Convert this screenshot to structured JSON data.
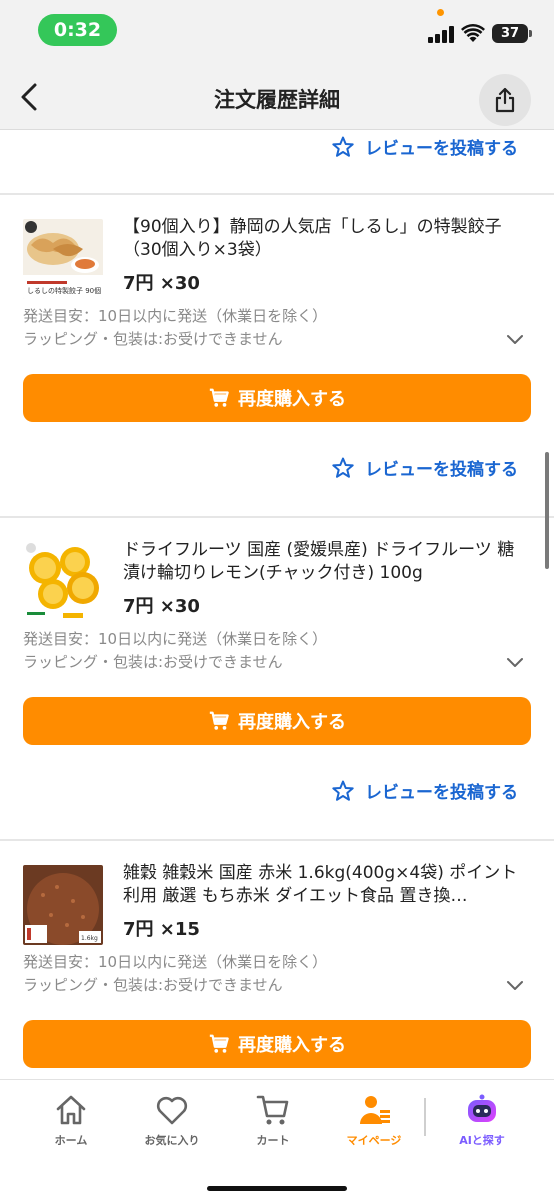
{
  "status_bar": {
    "time": "0:32",
    "battery": "37"
  },
  "header": {
    "title": "注文履歴詳細"
  },
  "review_label": "レビューを投稿する",
  "items": [
    {
      "title": "【90個入り】静岡の人気店「しるし」の特製餃子（30個入り×3袋）",
      "price": "7円 ×30",
      "ship": "発送目安：10日以内に発送（休業日を除く）",
      "wrap": "ラッピング・包装は:お受けできません",
      "button": "再度購入する",
      "thumb_label": "しるしの特製餃子 90個"
    },
    {
      "title": "ドライフルーツ 国産 (愛媛県産) ドライフルーツ 糖漬け輪切りレモン(チャック付き) 100g",
      "price": "7円 ×30",
      "ship": "発送目安：10日以内に発送（休業日を除く）",
      "wrap": "ラッピング・包装は:お受けできません",
      "button": "再度購入する"
    },
    {
      "title": "雑穀 雑穀米 国産 赤米 1.6kg(400g×4袋) ポイント利用 厳選 もち赤米 ダイエット食品 置き換…",
      "price": "7円 ×15",
      "ship": "発送目安：10日以内に発送（休業日を除く）",
      "wrap": "ラッピング・包装は:お受けできません",
      "button": "再度購入する",
      "thumb_label": "1.6kg"
    }
  ],
  "tabbar": {
    "tabs": [
      {
        "label": "ホーム",
        "icon": "home-icon"
      },
      {
        "label": "お気に入り",
        "icon": "heart-icon"
      },
      {
        "label": "カート",
        "icon": "cart-icon"
      },
      {
        "label": "マイページ",
        "icon": "mypage-icon",
        "active": true
      },
      {
        "label": "AIと探す",
        "icon": "ai-robot-icon"
      }
    ]
  },
  "colors": {
    "accent": "#ff8c00",
    "link": "#1a66d1",
    "time_pill": "#34c759"
  }
}
